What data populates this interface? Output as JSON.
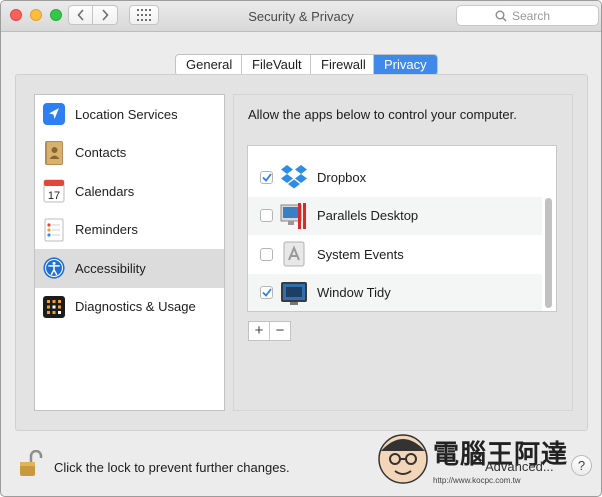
{
  "window": {
    "title": "Security & Privacy"
  },
  "toolbar": {
    "search_placeholder": "Search"
  },
  "tabs": [
    {
      "label": "General",
      "active": false
    },
    {
      "label": "FileVault",
      "active": false
    },
    {
      "label": "Firewall",
      "active": false
    },
    {
      "label": "Privacy",
      "active": true
    }
  ],
  "sidebar": {
    "items": [
      {
        "label": "Location Services",
        "icon": "location-icon",
        "selected": false
      },
      {
        "label": "Contacts",
        "icon": "contacts-icon",
        "selected": false
      },
      {
        "label": "Calendars",
        "icon": "calendar-icon",
        "selected": false,
        "icon_text": "17"
      },
      {
        "label": "Reminders",
        "icon": "reminders-icon",
        "selected": false
      },
      {
        "label": "Accessibility",
        "icon": "accessibility-icon",
        "selected": true
      },
      {
        "label": "Diagnostics & Usage",
        "icon": "diagnostics-icon",
        "selected": false
      }
    ]
  },
  "main": {
    "description": "Allow the apps below to control your computer.",
    "apps": [
      {
        "label": "Dropbox",
        "checked": true,
        "icon": "dropbox-icon"
      },
      {
        "label": "Parallels Desktop",
        "checked": false,
        "icon": "parallels-icon"
      },
      {
        "label": "System Events",
        "checked": false,
        "icon": "system-events-icon"
      },
      {
        "label": "Window Tidy",
        "checked": true,
        "icon": "window-tidy-icon"
      }
    ],
    "add_label": "+",
    "remove_label": "−"
  },
  "footer": {
    "lock_text": "Click the lock to prevent further changes.",
    "advanced_label": "Advanced...",
    "help_label": "?"
  },
  "watermark": {
    "text": "電腦王阿達",
    "url": "http://www.kocpc.com.tw"
  },
  "colors": {
    "accent": "#3f8ae8",
    "selected_row": "#dcdcdc"
  }
}
